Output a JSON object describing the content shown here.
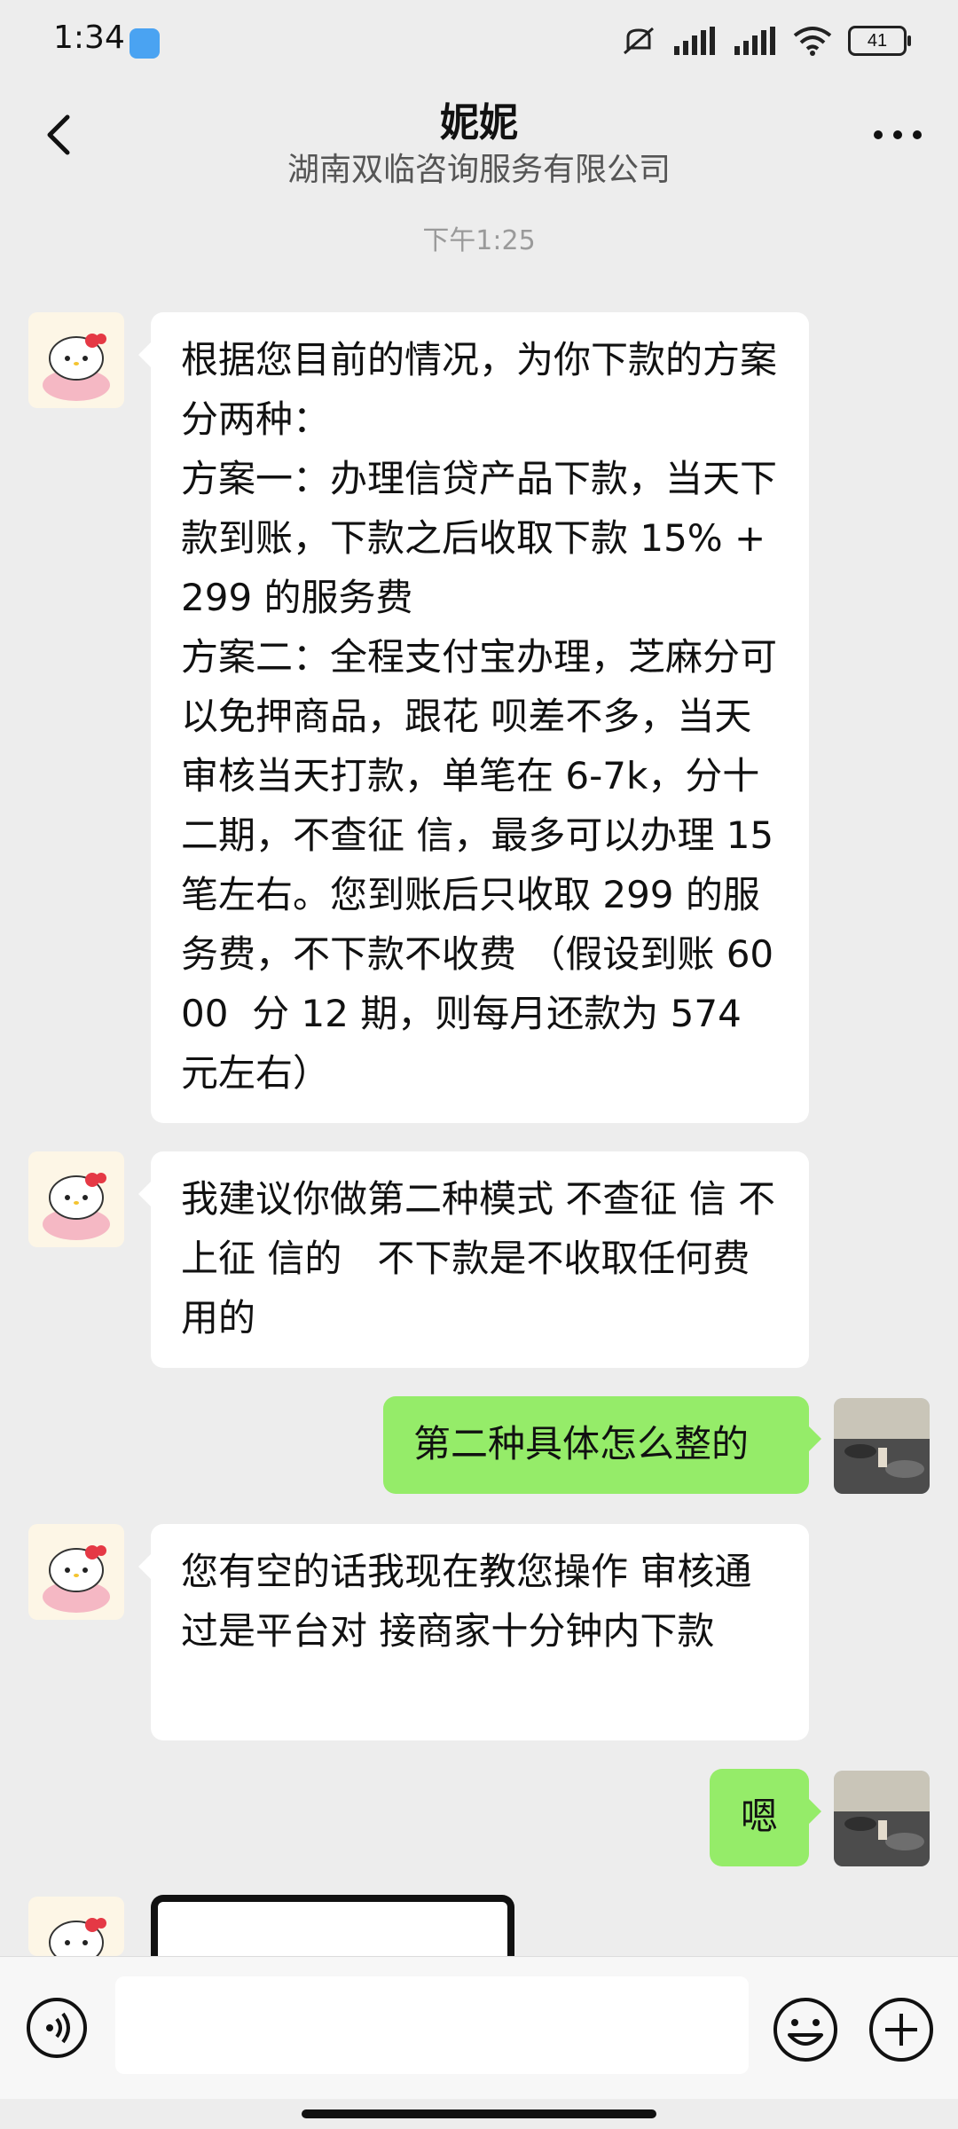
{
  "status_bar": {
    "time": "1:34",
    "battery": "41"
  },
  "header": {
    "title": "妮妮",
    "subtitle": "湖南双临咨询服务有限公司"
  },
  "chat": {
    "time_label": "下午1:25",
    "messages": [
      {
        "sender": "other",
        "text": "根据您目前的情况，为你下款的方案分两种：\n方案一：办理信贷产品下款，当天下款到账，下款之后收取下款 15% +299 的服务费\n方案二：全程支付宝办理，芝麻分可以免押商品，跟花 呗差不多，当天审核当天打款，单笔在 6-7k，分十二期，不查征 信，最多可以办理 15 笔左右。您到账后只收取 299 的服务费，不下款不收费 （假设到账 6000  分 12 期，则每月还款为 574 元左右）"
      },
      {
        "sender": "other",
        "text": "我建议你做第二种模式 不查征 信 不上征 信的   不下款是不收取任何费用的"
      },
      {
        "sender": "me",
        "text": "第二种具体怎么整的"
      },
      {
        "sender": "other",
        "text": "您有空的话我现在教您操作 审核通过是平台对 接商家十分钟内下款"
      },
      {
        "sender": "me",
        "text": "嗯"
      }
    ]
  },
  "input_bar": {
    "input_value": "",
    "icons": [
      "voice-icon",
      "emoji-icon",
      "plus-icon"
    ]
  },
  "colors": {
    "background": "#ededed",
    "bubble_other": "#ffffff",
    "bubble_me": "#95ec69"
  }
}
